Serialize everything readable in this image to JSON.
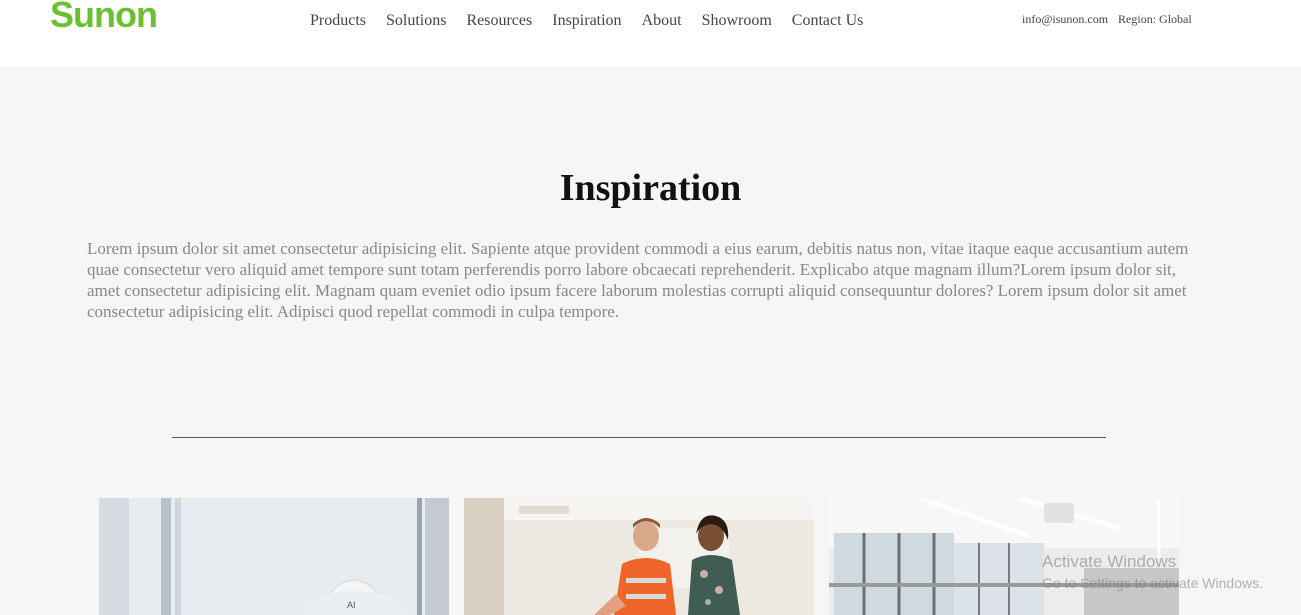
{
  "brand": {
    "logo_text": "Sunon",
    "accent": "#6cbf2e"
  },
  "nav": {
    "items": [
      "Products",
      "Solutions",
      "Resources",
      "Inspiration",
      "About",
      "Showroom",
      "Contact Us"
    ]
  },
  "header": {
    "email": "info@isunon.com",
    "region": "Region: Global"
  },
  "hero": {
    "title": "Inspiration",
    "body": "Lorem ipsum dolor sit amet consectetur adipisicing elit. Sapiente atque provident commodi a eius earum, debitis natus non, vitae itaque eaque accusantium autem quae consectetur vero aliquid amet tempore sunt totam perferendis porro labore obcaecati reprehenderit. Explicabo atque magnam illum?Lorem ipsum dolor sit, amet consectetur adipisicing elit. Magnam quam eveniet odio ipsum facere laborum molestias corrupti aliquid consequuntur dolores? Lorem ipsum dolor sit amet consectetur adipisicing elit. Adipisci quod repellat commodi in culpa tempore."
  },
  "cards": [
    {
      "subject": "construction-worker-helmet",
      "helmet_text": "AI"
    },
    {
      "subject": "team-meeting"
    },
    {
      "subject": "modern-office-interior"
    }
  ],
  "watermark": {
    "line1": "Activate Windows",
    "line2": "Go to Settings to activate Windows."
  }
}
